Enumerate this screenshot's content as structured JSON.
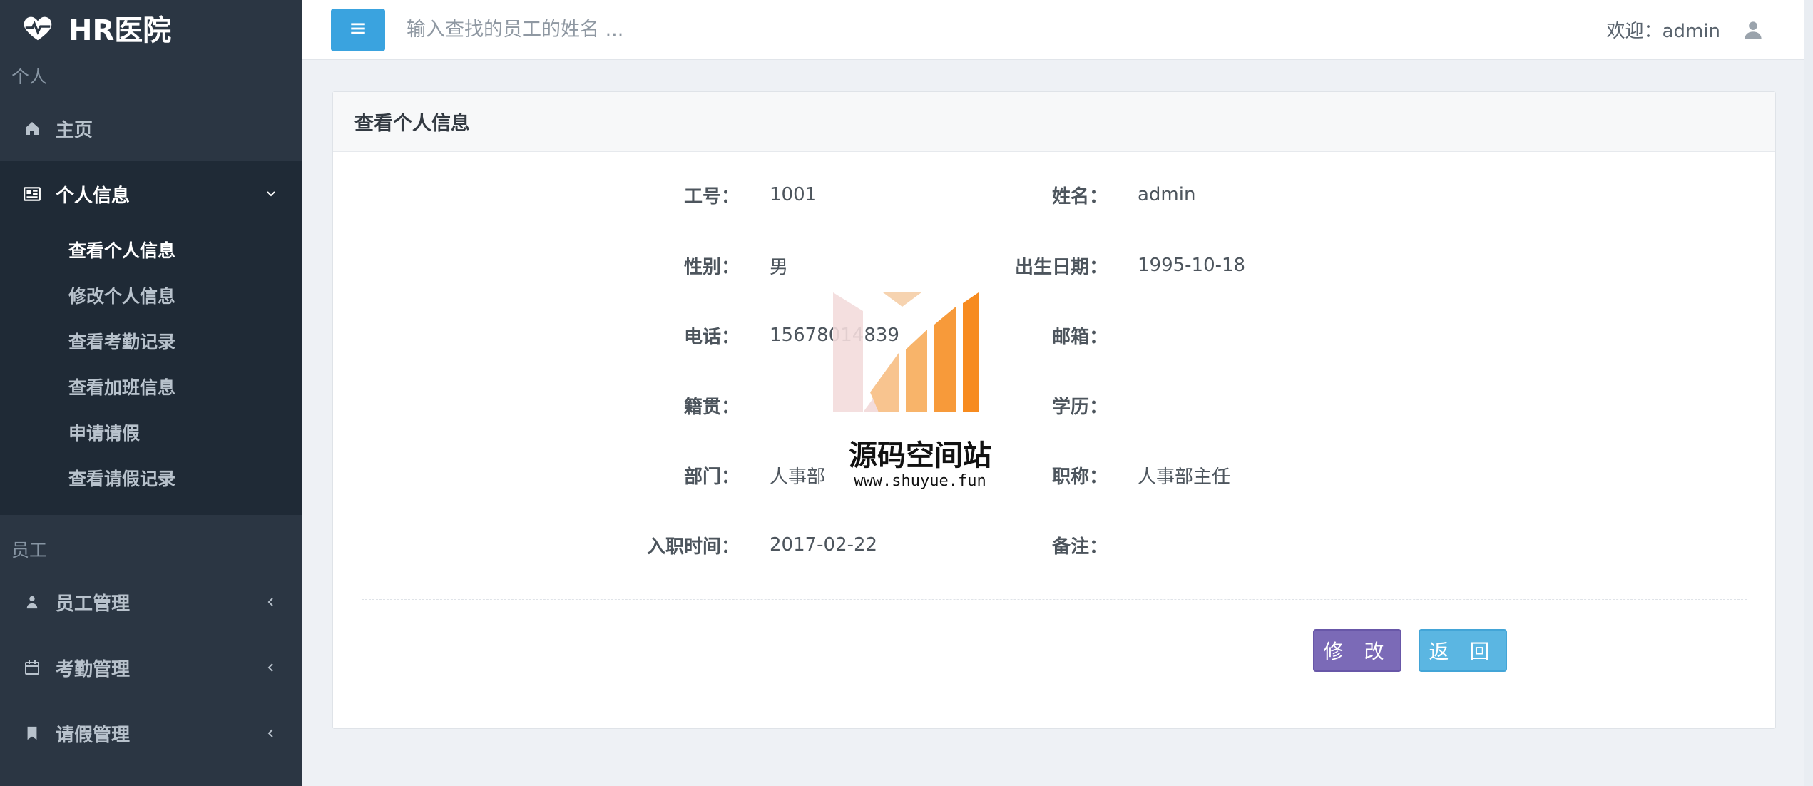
{
  "brand": {
    "title": "HR医院"
  },
  "sidebar": {
    "section_personal": "个人",
    "home": "主页",
    "personal_info": "个人信息",
    "personal_sub": [
      "查看个人信息",
      "修改个人信息",
      "查看考勤记录",
      "查看加班信息",
      "申请请假",
      "查看请假记录"
    ],
    "section_staff": "员工",
    "staff_items": [
      "员工管理",
      "考勤管理",
      "请假管理"
    ]
  },
  "topbar": {
    "search_placeholder": "输入查找的员工的姓名 ...",
    "welcome": "欢迎：admin"
  },
  "panel": {
    "title": "查看个人信息",
    "fields": [
      {
        "label": "工号：",
        "value": "1001"
      },
      {
        "label": "姓名：",
        "value": "admin"
      },
      {
        "label": "性别：",
        "value": "男"
      },
      {
        "label": "出生日期：",
        "value": "1995-10-18"
      },
      {
        "label": "电话：",
        "value": "15678014839"
      },
      {
        "label": "邮箱：",
        "value": ""
      },
      {
        "label": "籍贯：",
        "value": ""
      },
      {
        "label": "学历：",
        "value": ""
      },
      {
        "label": "部门：",
        "value": "人事部"
      },
      {
        "label": "职称：",
        "value": "人事部主任"
      },
      {
        "label": "入职时间：",
        "value": "2017-02-22"
      },
      {
        "label": "备注：",
        "value": ""
      }
    ],
    "edit_button": "修 改",
    "back_button": "返 回"
  },
  "watermark": {
    "line1": "源码空间站",
    "line2": "www.shuyue.fun"
  },
  "colors": {
    "sidebar_bg": "#2b3643",
    "accent_blue": "#3aa3df",
    "edit_purple": "#7b6ab7",
    "back_blue": "#5bb6e2"
  }
}
